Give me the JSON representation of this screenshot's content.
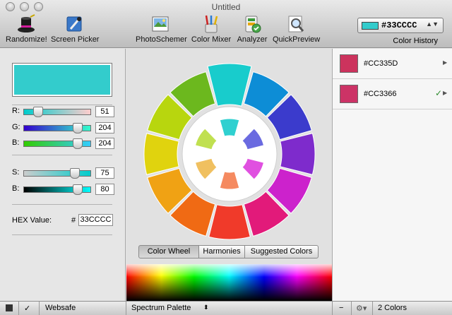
{
  "window": {
    "title": "Untitled"
  },
  "toolbar": {
    "randomize_label": "Randomize!",
    "screen_picker_label": "Screen Picker",
    "photoschemer_label": "PhotoSchemer",
    "color_mixer_label": "Color Mixer",
    "analyzer_label": "Analyzer",
    "quickpreview_label": "QuickPreview",
    "color_history_value": "#33CCCC",
    "color_history_label": "Color History"
  },
  "left": {
    "swatch_color": "#33cccc",
    "rgb": [
      {
        "label": "R:",
        "value": "51"
      },
      {
        "label": "G:",
        "value": "204"
      },
      {
        "label": "B:",
        "value": "204"
      }
    ],
    "sb": [
      {
        "label": "S:",
        "value": "75"
      },
      {
        "label": "B:",
        "value": "80"
      }
    ],
    "hex_label": "HEX Value:",
    "hex_hash": "#",
    "hex_value": "33CCCC"
  },
  "center": {
    "tabs": [
      "Color Wheel",
      "Harmonies",
      "Suggested Colors"
    ],
    "selected_tab": "Color Wheel"
  },
  "history": [
    {
      "hex": "#CC335D",
      "color": "#cc335d",
      "checked": false
    },
    {
      "hex": "#CC3366",
      "color": "#cc3366",
      "checked": true
    }
  ],
  "bottom": {
    "websafe_label": "Websafe",
    "palette_label": "Spectrum Palette",
    "count_label": "2 Colors",
    "check_glyph": "✓",
    "minus_glyph": "−",
    "gear_glyph": "⚙▾",
    "stepper_glyph": "⬍"
  },
  "glyphs": {
    "history_check": "✓",
    "history_arrow": "▶",
    "dropdown_arrow": "▲▼"
  }
}
